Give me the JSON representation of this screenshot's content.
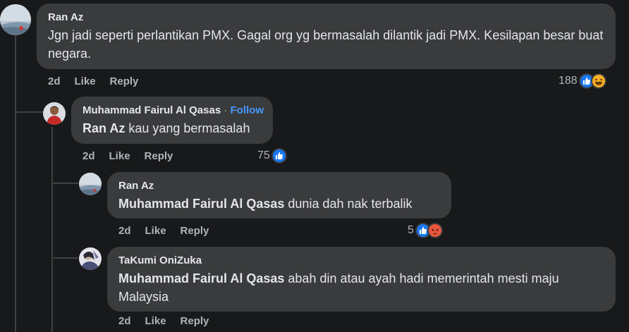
{
  "comments": [
    {
      "author": "Ran Az",
      "text": "Jgn jadi seperti perlantikan PMX. Gagal org yg bermasalah dilantik jadi PMX. Kesilapan besar buat negara.",
      "time": "2d",
      "like_label": "Like",
      "reply_label": "Reply",
      "reaction_count": "188",
      "reactions": [
        "like-icon",
        "haha-icon"
      ]
    },
    {
      "author": "Muhammad Fairul Al Qasas",
      "separator": " · ",
      "follow_label": "Follow",
      "mention": "Ran Az",
      "text": " kau yang bermasalah",
      "time": "2d",
      "like_label": "Like",
      "reply_label": "Reply",
      "reaction_count": "75",
      "reactions": [
        "like-icon"
      ]
    },
    {
      "author": "Ran Az",
      "mention": "Muhammad Fairul Al Qasas",
      "text": " dunia dah nak terbalik",
      "time": "2d",
      "like_label": "Like",
      "reply_label": "Reply",
      "reaction_count": "5",
      "reactions": [
        "like-icon",
        "angry-icon"
      ]
    },
    {
      "author": "TaKumi OniZuka",
      "mention": "Muhammad Fairul Al Qasas",
      "text": " abah din atau ayah hadi memerintah mesti maju Malaysia",
      "time": "2d",
      "like_label": "Like",
      "reply_label": "Reply"
    }
  ],
  "colors": {
    "background": "#18191a",
    "bubble": "#3a3b3c",
    "link_blue": "#4599ff",
    "like_blue": "#1877f2",
    "haha_yellow": "#f7b125",
    "angry_red": "#e9573e"
  }
}
